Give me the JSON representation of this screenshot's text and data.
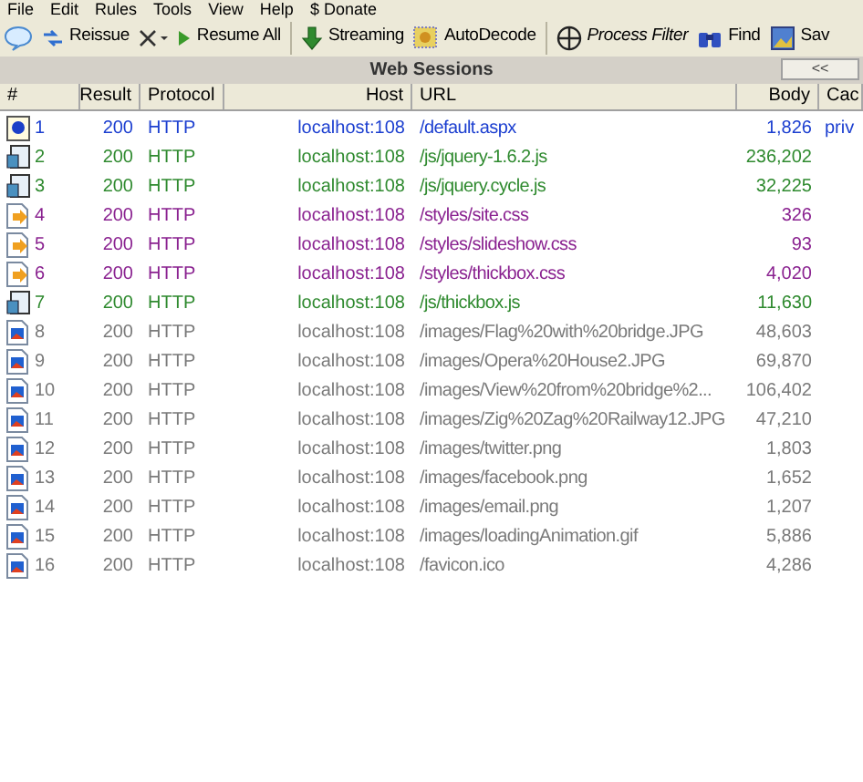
{
  "menu": [
    "File",
    "Edit",
    "Rules",
    "Tools",
    "View",
    "Help",
    "$ Donate"
  ],
  "toolbar": [
    {
      "kind": "comment"
    },
    {
      "kind": "reissue",
      "label": "Reissue"
    },
    {
      "kind": "remove"
    },
    {
      "kind": "resume",
      "label": "Resume All"
    },
    {
      "kind": "streaming",
      "label": "Streaming"
    },
    {
      "kind": "autodecode",
      "label": "AutoDecode"
    },
    {
      "kind": "filter",
      "label": "Process Filter"
    },
    {
      "kind": "find",
      "label": "Find"
    },
    {
      "kind": "save",
      "label": "Sav"
    }
  ],
  "panel": {
    "title": "Web Sessions",
    "collapse": "<<"
  },
  "columns": [
    "#",
    "Result",
    "Protocol",
    "Host",
    "URL",
    "Body",
    "Cac"
  ],
  "rows": [
    {
      "kind": "html",
      "num": "1",
      "result": "200",
      "protocol": "HTTP",
      "host": "localhost:108",
      "url": "/default.aspx",
      "body": "1,826",
      "caching": "priv"
    },
    {
      "kind": "js",
      "num": "2",
      "result": "200",
      "protocol": "HTTP",
      "host": "localhost:108",
      "url": "/js/jquery-1.6.2.js",
      "body": "236,202"
    },
    {
      "kind": "js",
      "num": "3",
      "result": "200",
      "protocol": "HTTP",
      "host": "localhost:108",
      "url": "/js/jquery.cycle.js",
      "body": "32,225"
    },
    {
      "kind": "css",
      "num": "4",
      "result": "200",
      "protocol": "HTTP",
      "host": "localhost:108",
      "url": "/styles/site.css",
      "body": "326"
    },
    {
      "kind": "css",
      "num": "5",
      "result": "200",
      "protocol": "HTTP",
      "host": "localhost:108",
      "url": "/styles/slideshow.css",
      "body": "93"
    },
    {
      "kind": "css",
      "num": "6",
      "result": "200",
      "protocol": "HTTP",
      "host": "localhost:108",
      "url": "/styles/thickbox.css",
      "body": "4,020"
    },
    {
      "kind": "js",
      "num": "7",
      "result": "200",
      "protocol": "HTTP",
      "host": "localhost:108",
      "url": "/js/thickbox.js",
      "body": "11,630"
    },
    {
      "kind": "image",
      "num": "8",
      "result": "200",
      "protocol": "HTTP",
      "host": "localhost:108",
      "url": "/images/Flag%20with%20bridge.JPG",
      "body": "48,603"
    },
    {
      "kind": "image",
      "num": "9",
      "result": "200",
      "protocol": "HTTP",
      "host": "localhost:108",
      "url": "/images/Opera%20House2.JPG",
      "body": "69,870"
    },
    {
      "kind": "image",
      "num": "10",
      "result": "200",
      "protocol": "HTTP",
      "host": "localhost:108",
      "url": "/images/View%20from%20bridge%2...",
      "body": "106,402"
    },
    {
      "kind": "image",
      "num": "11",
      "result": "200",
      "protocol": "HTTP",
      "host": "localhost:108",
      "url": "/images/Zig%20Zag%20Railway12.JPG",
      "body": "47,210"
    },
    {
      "kind": "image",
      "num": "12",
      "result": "200",
      "protocol": "HTTP",
      "host": "localhost:108",
      "url": "/images/twitter.png",
      "body": "1,803"
    },
    {
      "kind": "image",
      "num": "13",
      "result": "200",
      "protocol": "HTTP",
      "host": "localhost:108",
      "url": "/images/facebook.png",
      "body": "1,652"
    },
    {
      "kind": "image",
      "num": "14",
      "result": "200",
      "protocol": "HTTP",
      "host": "localhost:108",
      "url": "/images/email.png",
      "body": "1,207"
    },
    {
      "kind": "image",
      "num": "15",
      "result": "200",
      "protocol": "HTTP",
      "host": "localhost:108",
      "url": "/images/loadingAnimation.gif",
      "body": "5,886"
    },
    {
      "kind": "image",
      "num": "16",
      "result": "200",
      "protocol": "HTTP",
      "host": "localhost:108",
      "url": "/favicon.ico",
      "body": "4,286"
    }
  ]
}
